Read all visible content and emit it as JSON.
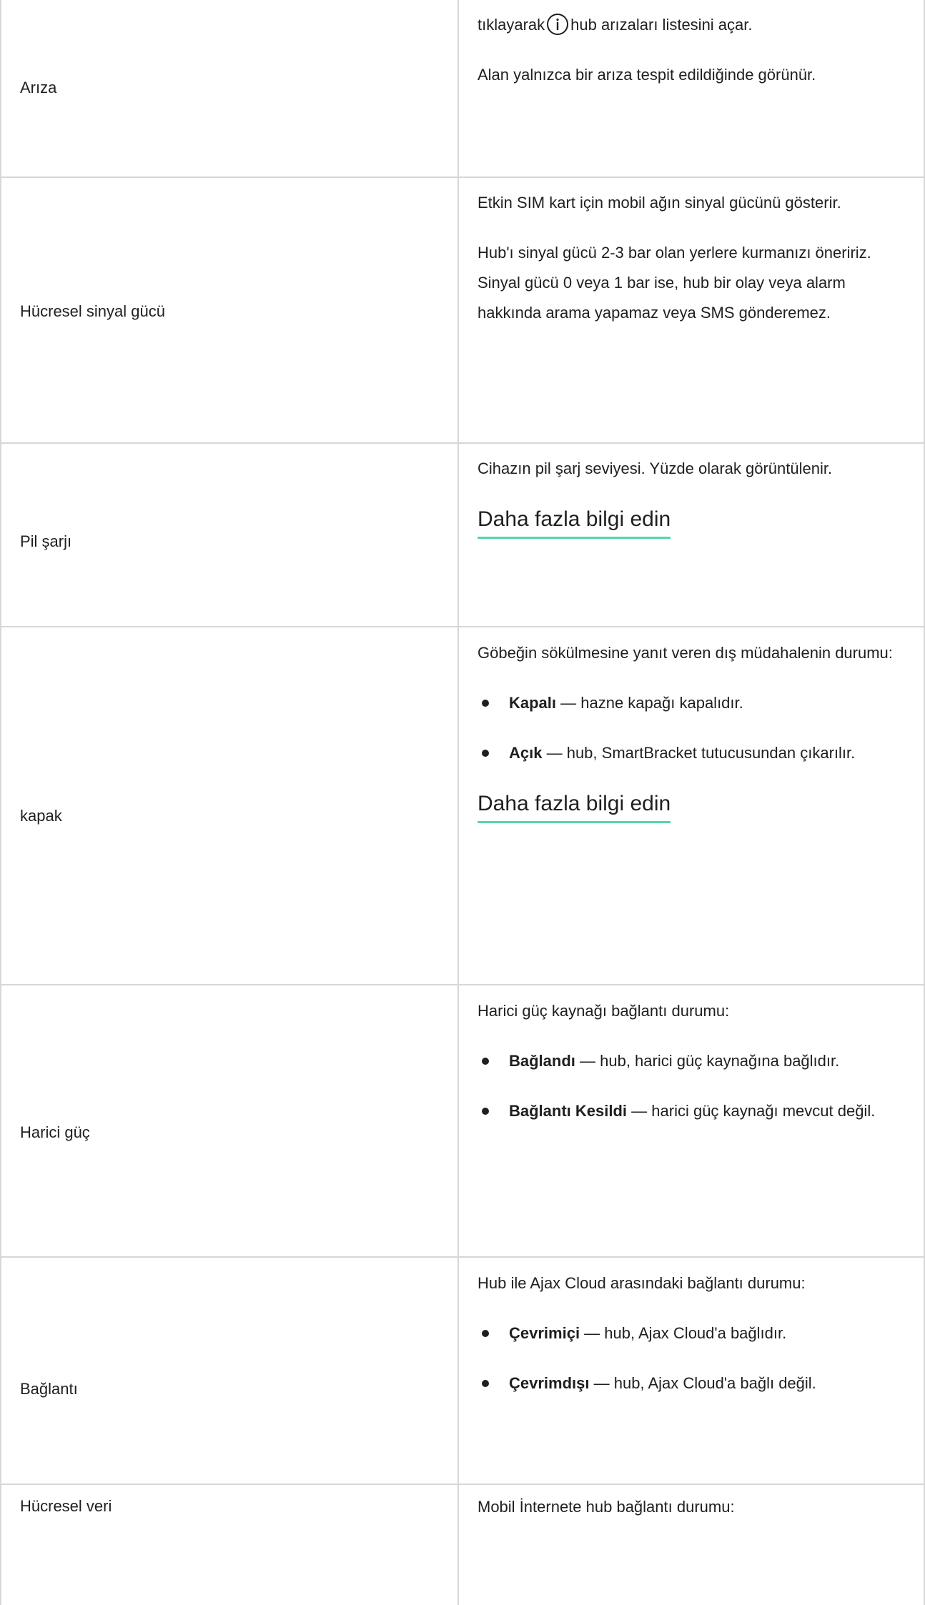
{
  "rows": [
    {
      "label": "Arıza",
      "text_before_icon": "tıklayarak",
      "text_after_icon": "hub arızaları listesini açar.",
      "note": "Alan yalnızca bir arıza tespit edildiğinde görünür."
    },
    {
      "label": "Hücresel sinyal gücü",
      "p1": "Etkin SIM kart için mobil ağın sinyal gücünü gösterir.",
      "p2": "Hub'ı sinyal gücü 2-3 bar olan yerlere kurmanızı öneririz. Sinyal gücü 0 veya 1 bar ise, hub bir olay veya alarm hakkında arama yapamaz veya SMS gönderemez."
    },
    {
      "label": "Pil şarjı",
      "p1": "Cihazın pil şarj seviyesi. Yüzde olarak görüntülenir.",
      "link": "Daha fazla bilgi edin"
    },
    {
      "label": "kapak",
      "p1": "Göbeğin sökülmesine yanıt veren dış müdahalenin durumu:",
      "bullets": [
        {
          "term": "Kapalı",
          "desc": " — hazne kapağı kapalıdır."
        },
        {
          "term": "Açık",
          "desc": " — hub, SmartBracket tutucusundan çıkarılır."
        }
      ],
      "link": "Daha fazla bilgi edin"
    },
    {
      "label": "Harici güç",
      "p1": "Harici güç kaynağı bağlantı durumu:",
      "bullets": [
        {
          "term": "Bağlandı",
          "desc": " — hub, harici güç kaynağına bağlıdır."
        },
        {
          "term": "Bağlantı Kesildi",
          "desc": " — harici güç kaynağı mevcut değil."
        }
      ]
    },
    {
      "label": "Bağlantı",
      "p1": "Hub ile Ajax Cloud arasındaki bağlantı durumu:",
      "bullets": [
        {
          "term": "Çevrimiçi",
          "desc": " — hub, Ajax Cloud'a bağlıdır."
        },
        {
          "term": "Çevrimdışı",
          "desc": " — hub, Ajax Cloud'a bağlı değil."
        }
      ]
    },
    {
      "label": "Hücresel veri",
      "p1": "Mobil İnternete hub bağlantı durumu:"
    }
  ],
  "icons": {
    "info": "info-circle-icon",
    "bullet": "bullet-dot-icon"
  },
  "colors": {
    "link_underline": "#55d6a8",
    "border": "#d7d7d7"
  }
}
